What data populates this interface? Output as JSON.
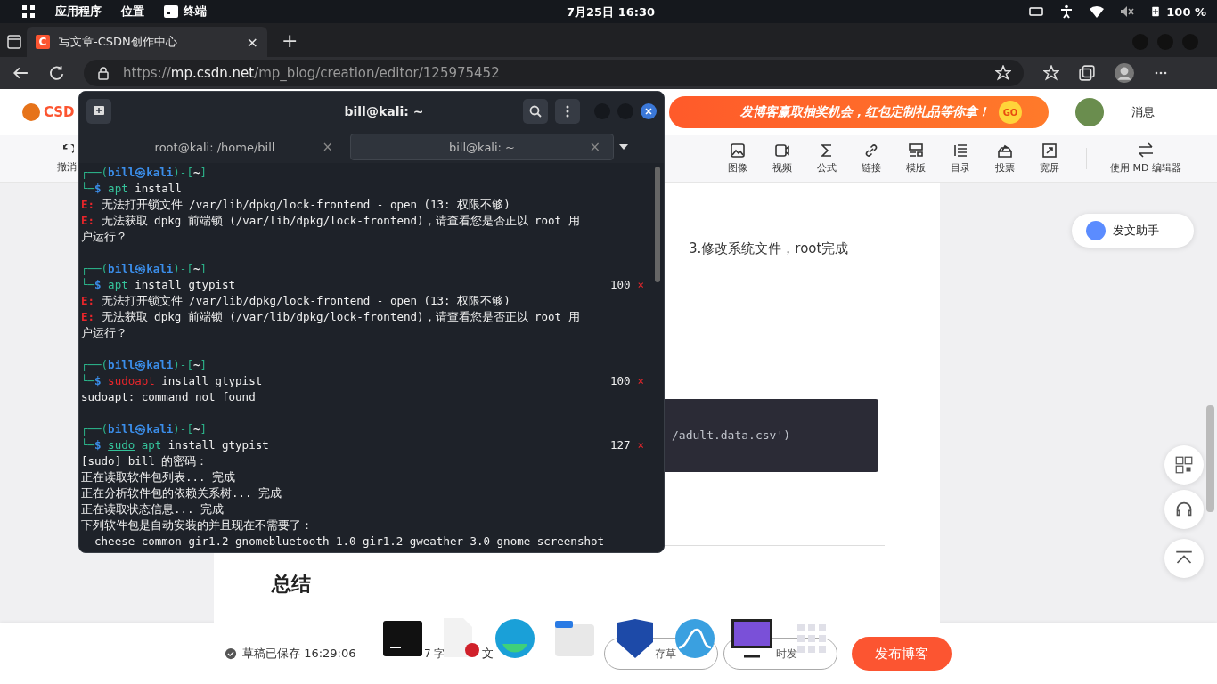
{
  "top_bar": {
    "menus": [
      {
        "label": "应用程序",
        "kind": "text"
      },
      {
        "label": "位置",
        "kind": "text"
      },
      {
        "label": "终端",
        "kind": "app"
      }
    ],
    "clock": "7月25日  16:30",
    "battery": "100 %"
  },
  "browser": {
    "tab": {
      "favicon": "C",
      "title": "写文章-CSDN创作中心",
      "close": "×"
    },
    "new_tab": "+",
    "url_scheme": "https://",
    "url_host": "mp.csdn.net",
    "url_path": "/mp_blog/creation/editor/125975452"
  },
  "header": {
    "logo": "CSD",
    "banner": "发博客赢取抽奖机会，红包定制礼品等你拿！",
    "banner_go": "GO",
    "messages": "消息"
  },
  "toolbar": {
    "undo": "撤消",
    "tools": [
      {
        "label": "图像"
      },
      {
        "label": "视频"
      },
      {
        "label": "公式"
      },
      {
        "label": "链接"
      },
      {
        "label": "模版"
      },
      {
        "label": "目录"
      },
      {
        "label": "投票"
      },
      {
        "label": "宽屏"
      }
    ],
    "switch_editor": "使用 MD 编辑器"
  },
  "article": {
    "list_item": "3.修改系统文件，root完成",
    "code_tail": "/adult.data.csv')",
    "heading": "总结"
  },
  "assistant": "发文助手",
  "footer": {
    "saved": "草稿已保存 16:29:06",
    "word_count": "7 字",
    "settings_tail": "文",
    "save_draft": "存草",
    "schedule": "时发",
    "publish": "发布博客"
  },
  "terminal": {
    "title": "bill@kali: ~",
    "tabs": [
      {
        "label": "root@kali: /home/bill",
        "close": "×",
        "selected": false
      },
      {
        "label": "bill@kali: ~",
        "close": "×",
        "selected": true
      }
    ],
    "lines": [
      {
        "kind": "prompt",
        "open": "┌──(",
        "who": "bill㉿kali",
        "mid": ")-[",
        "dir": "~",
        "end": "]"
      },
      {
        "kind": "command",
        "marker": "└─$",
        "tokens": [
          {
            "text": "apt",
            "kind": "program",
            "underlined": false
          },
          {
            "text": "install",
            "kind": "arg",
            "underlined": false
          }
        ]
      },
      {
        "kind": "error",
        "prefix": "E:",
        "text": "无法打开锁文件 /var/lib/dpkg/lock-frontend - open (13: 权限不够)"
      },
      {
        "kind": "error",
        "prefix": "E:",
        "text": "无法获取 dpkg 前端锁 (/var/lib/dpkg/lock-frontend)，请查看您是否正以 root 用"
      },
      {
        "kind": "output",
        "text": "户运行？"
      },
      {
        "kind": "blank"
      },
      {
        "kind": "prompt",
        "open": "┌──(",
        "who": "bill㉿kali",
        "mid": ")-[",
        "dir": "~",
        "end": "]"
      },
      {
        "kind": "command",
        "marker": "└─$",
        "tokens": [
          {
            "text": "apt",
            "kind": "program",
            "underlined": false
          },
          {
            "text": "install gtypist",
            "kind": "arg",
            "underlined": false
          }
        ],
        "status": "100",
        "status_mark": "×"
      },
      {
        "kind": "error",
        "prefix": "E:",
        "text": "无法打开锁文件 /var/lib/dpkg/lock-frontend - open (13: 权限不够)"
      },
      {
        "kind": "error",
        "prefix": "E:",
        "text": "无法获取 dpkg 前端锁 (/var/lib/dpkg/lock-frontend)，请查看您是否正以 root 用"
      },
      {
        "kind": "output",
        "text": "户运行？"
      },
      {
        "kind": "blank"
      },
      {
        "kind": "prompt",
        "open": "┌──(",
        "who": "bill㉿kali",
        "mid": ")-[",
        "dir": "~",
        "end": "]"
      },
      {
        "kind": "command",
        "marker": "└─$",
        "tokens": [
          {
            "text": "sudoapt",
            "kind": "invalid",
            "underlined": false
          },
          {
            "text": "install gtypist",
            "kind": "arg",
            "underlined": false
          }
        ],
        "status": "100",
        "status_mark": "×"
      },
      {
        "kind": "output",
        "text": "sudoapt: command not found"
      },
      {
        "kind": "blank"
      },
      {
        "kind": "prompt",
        "open": "┌──(",
        "who": "bill㉿kali",
        "mid": ")-[",
        "dir": "~",
        "end": "]"
      },
      {
        "kind": "command",
        "marker": "└─$",
        "tokens": [
          {
            "text": "sudo",
            "kind": "program",
            "underlined": true
          },
          {
            "text": "apt",
            "kind": "program",
            "underlined": false
          },
          {
            "text": "install gtypist",
            "kind": "arg",
            "underlined": false
          }
        ],
        "status": "127",
        "status_mark": "×"
      },
      {
        "kind": "output",
        "text": "[sudo] bill 的密码："
      },
      {
        "kind": "output",
        "text": "正在读取软件包列表... 完成"
      },
      {
        "kind": "output",
        "text": "正在分析软件包的依赖关系树... 完成"
      },
      {
        "kind": "output",
        "text": "正在读取状态信息... 完成"
      },
      {
        "kind": "output",
        "text": "下列软件包是自动安装的并且现在不需要了："
      },
      {
        "kind": "output",
        "text": "  cheese-common gir1.2-gnomebluetooth-1.0 gir1.2-gweather-3.0 gnome-screenshot"
      }
    ]
  }
}
